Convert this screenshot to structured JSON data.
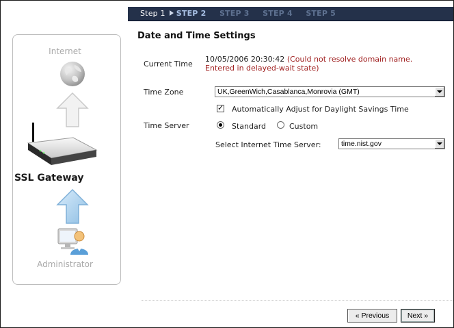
{
  "wizard": {
    "steps": [
      {
        "label": "Step 1",
        "state": "done"
      },
      {
        "label": "STEP 2",
        "state": "active"
      },
      {
        "label": "STEP 3",
        "state": "inactive"
      },
      {
        "label": "STEP 4",
        "state": "inactive"
      },
      {
        "label": "STEP 5",
        "state": "inactive"
      }
    ]
  },
  "diagram": {
    "internet_label": "Internet",
    "gateway_label": "SSL Gateway",
    "admin_label": "Administrator"
  },
  "form": {
    "title": "Date and Time Settings",
    "current_time_label": "Current Time",
    "current_time_value": "10/05/2006 20:30:42",
    "current_time_warning_line1": "(Could not resolve domain name.",
    "current_time_warning_line2": "Entered in delayed-wait state)",
    "time_zone_label": "Time Zone",
    "time_zone_value": "UK,GreenWich,Casablanca,Monrovia (GMT)",
    "dst_label": "Automatically Adjust for Daylight Savings Time",
    "dst_checked": true,
    "time_server_label": "Time Server",
    "server_option_standard": "Standard",
    "server_option_custom": "Custom",
    "server_selected": "Standard",
    "internet_time_server_label": "Select Internet Time Server:",
    "internet_time_server_value": "time.nist.gov"
  },
  "buttons": {
    "previous": "« Previous",
    "next": "Next »"
  },
  "colors": {
    "stepbar_bg": "#24314a",
    "step_active": "#a7bfe3",
    "step_inactive": "#5e7190",
    "warning": "#a02020"
  }
}
